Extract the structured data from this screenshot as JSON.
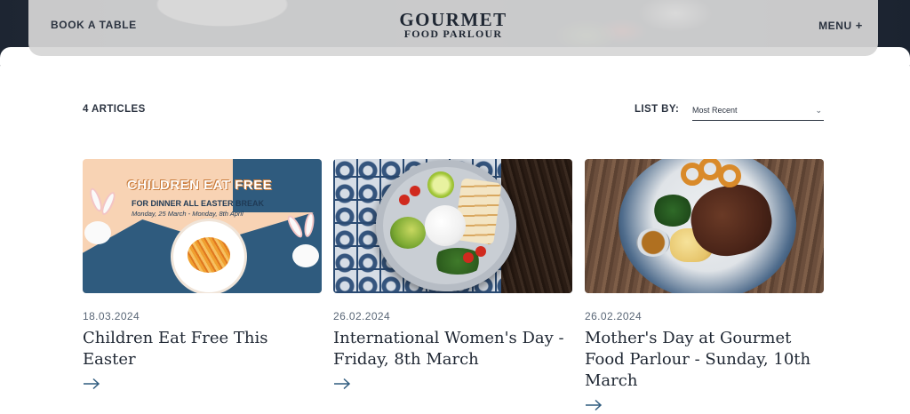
{
  "header": {
    "book_label": "BOOK A TABLE",
    "logo_line1": "GOURMET",
    "logo_line2": "FOOD PARLOUR",
    "menu_label": "MENU",
    "menu_icon": "plus-icon"
  },
  "listing": {
    "count_label": "4 ARTICLES",
    "sort_label": "LIST BY:",
    "sort_value": "Most Recent",
    "sort_icon": "chevron-down-icon"
  },
  "articles": [
    {
      "date": "18.03.2024",
      "title": "Children Eat Free This Easter",
      "image": {
        "headline": "CHILDREN EAT FREE",
        "subline": "FOR DINNER ALL EASTER BREAK",
        "dates": "Monday, 25 March - Monday, 8th April"
      }
    },
    {
      "date": "26.02.2024",
      "title": "International Women's Day - Friday, 8th March"
    },
    {
      "date": "26.02.2024",
      "title": "Mother's Day at Gourmet Food Parlour - Sunday, 10th March"
    }
  ],
  "colors": {
    "text_dark": "#1f2733",
    "header_bg": "#d6d6d6",
    "accent_blue": "#2f5b7e"
  }
}
